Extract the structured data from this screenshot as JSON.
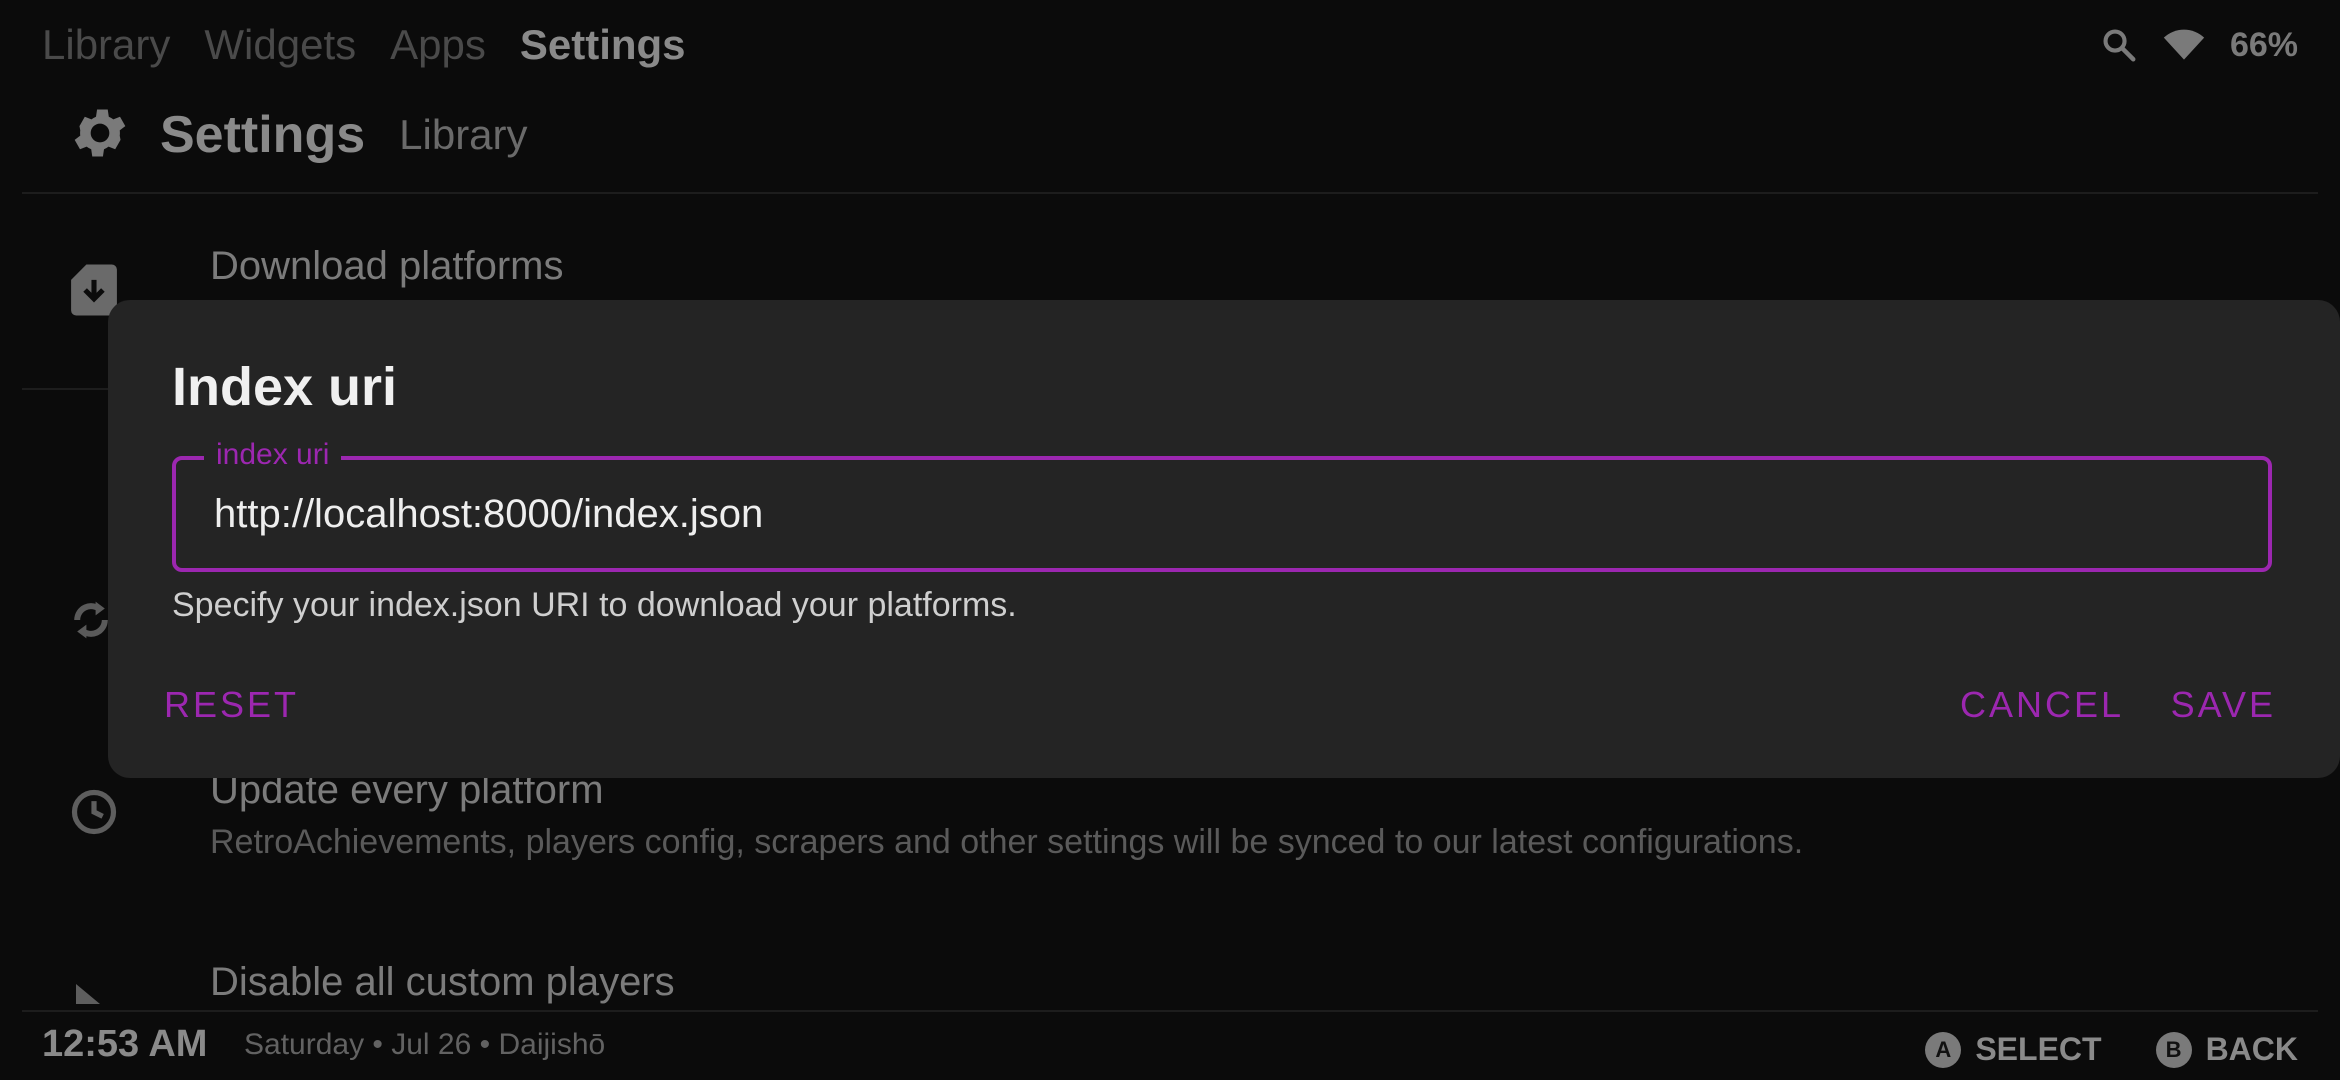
{
  "topnav": {
    "tabs": [
      "Library",
      "Widgets",
      "Apps",
      "Settings"
    ],
    "active": "Settings"
  },
  "status": {
    "battery": "66%",
    "icons": [
      "search-icon",
      "wifi-icon"
    ]
  },
  "header": {
    "title": "Settings",
    "breadcrumb": "Library",
    "icon": "gear-icon"
  },
  "rows": [
    {
      "title": "Download platforms",
      "icon": "sd-card-download-icon"
    },
    {
      "title": "",
      "icon": "sync-icon"
    },
    {
      "title": "Update every platform",
      "subtitle": "RetroAchievements, players config, scrapers and other settings will be synced to our latest configurations.",
      "icon": "history-icon"
    },
    {
      "title": "Disable all custom players",
      "icon": "play-icon"
    }
  ],
  "footer": {
    "time": "12:53 AM",
    "date": "Saturday • Jul 26 • Daijishō",
    "hints": [
      {
        "button": "A",
        "label": "SELECT"
      },
      {
        "button": "B",
        "label": "BACK"
      }
    ]
  },
  "dialog": {
    "title": "Index uri",
    "field_label": "index uri",
    "field_value": "http://localhost:8000/index.json",
    "help": "Specify your index.json URI to download your platforms.",
    "buttons": {
      "reset": "RESET",
      "cancel": "CANCEL",
      "save": "SAVE"
    },
    "accent": "#9c27b0"
  }
}
